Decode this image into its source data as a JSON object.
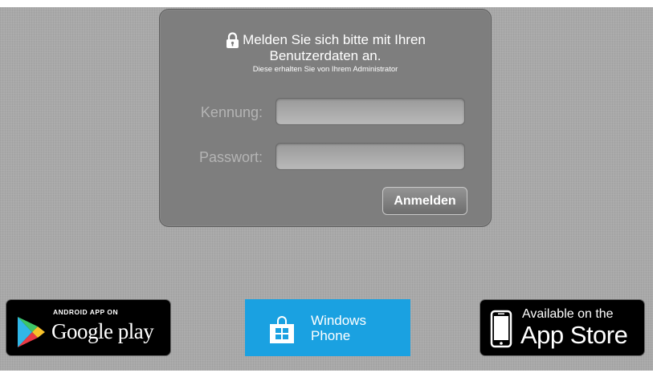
{
  "login": {
    "heading_line1": "Melden Sie sich bitte mit Ihren",
    "heading_line2": "Benutzerdaten an.",
    "note": "Diese erhalten Sie von Ihrem Administrator",
    "username_label": "Kennung:",
    "username_value": "",
    "password_label": "Passwort:",
    "password_value": "",
    "submit_label": "Anmelden",
    "lock_icon": "lock-icon"
  },
  "badges": {
    "google": {
      "small": "ANDROID APP ON",
      "big": "Google play",
      "icon": "google-play-icon"
    },
    "windows": {
      "line1": "Windows",
      "line2": "Phone",
      "icon": "windows-store-icon",
      "color": "#1aa1e1"
    },
    "apple": {
      "small": "Available on the",
      "big": "App Store",
      "icon": "iphone-icon"
    }
  },
  "colors": {
    "background": "#a9a9a9",
    "panel": "#7e7e7e",
    "label": "#b4b4b4"
  }
}
